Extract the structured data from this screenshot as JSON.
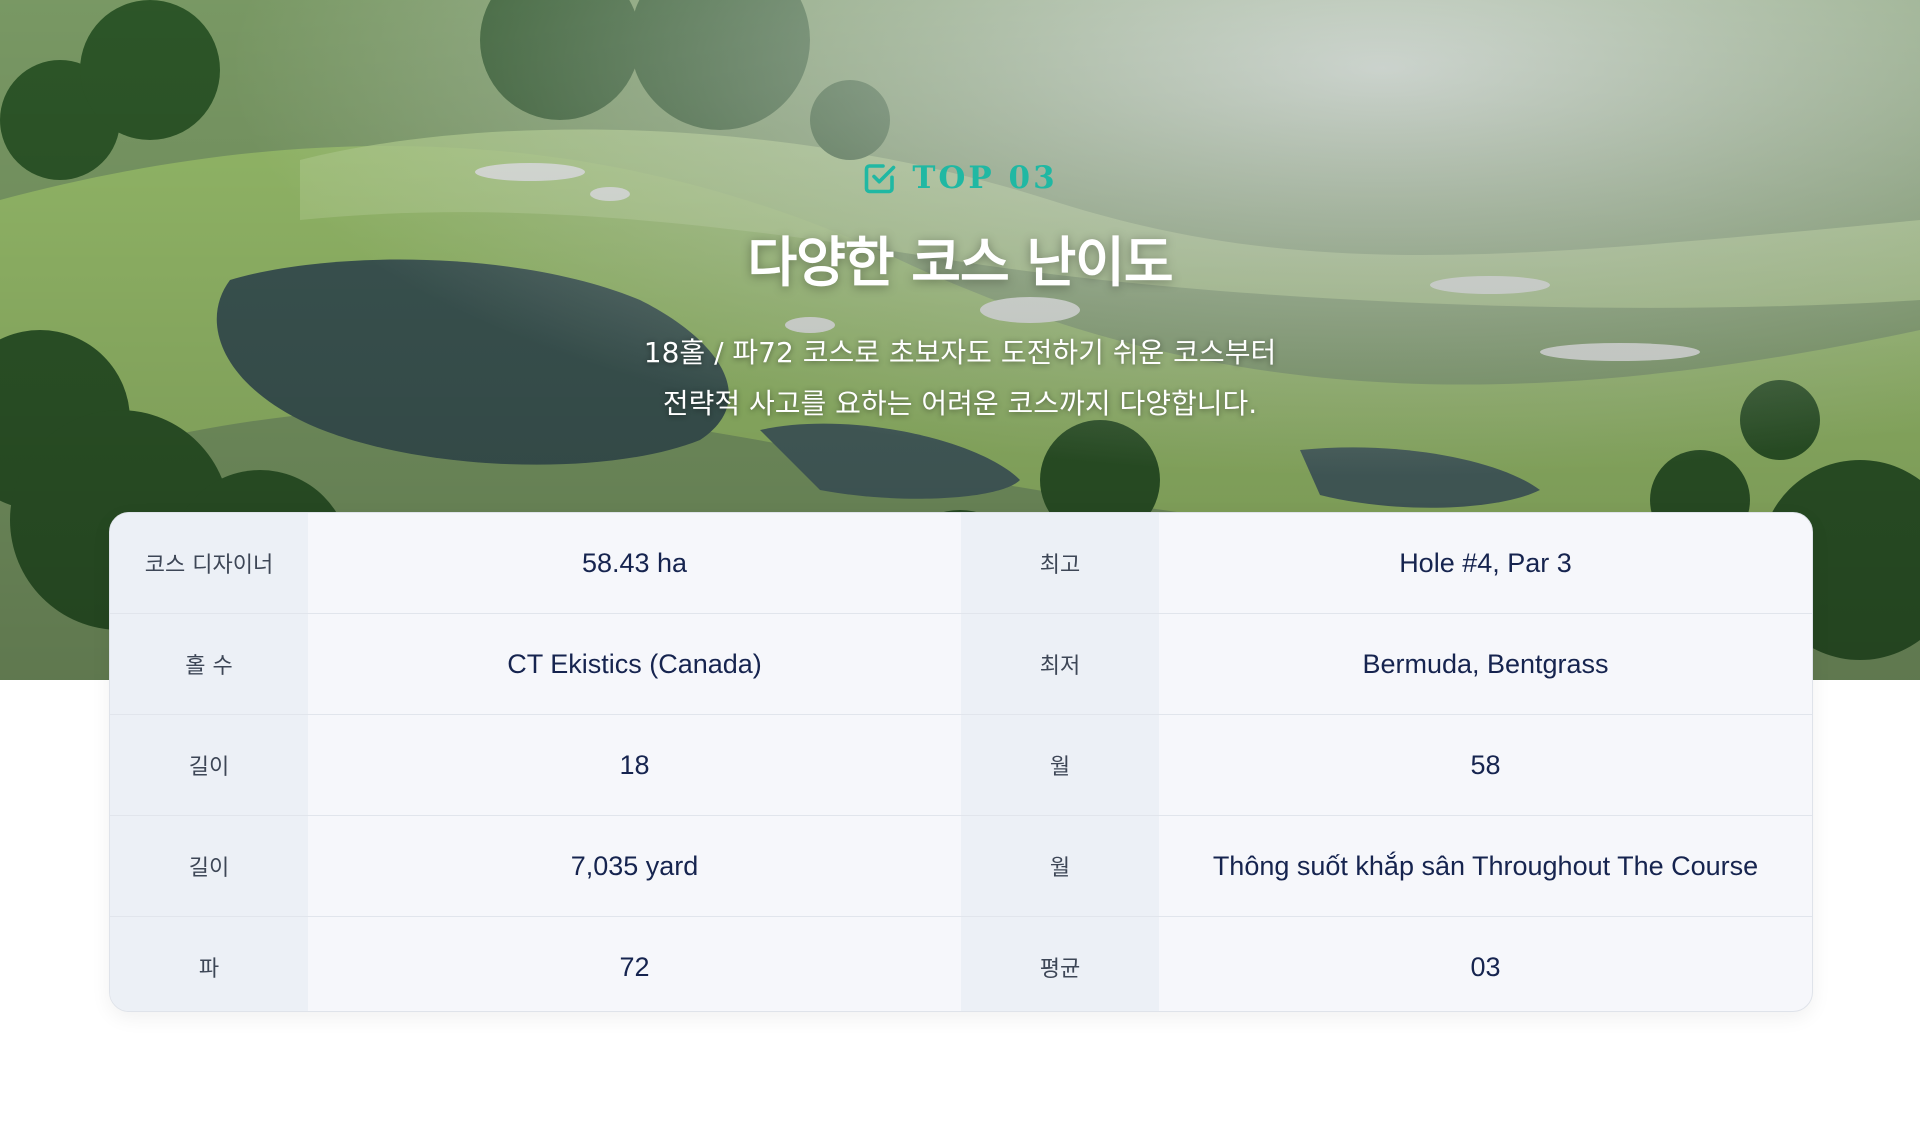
{
  "hero": {
    "badge_text": "TOP 03",
    "badge_icon": "check-square-icon",
    "title": "다양한 코스 난이도",
    "desc_line1": "18홀 / 파72 코스로 초보자도 도전하기 쉬운 코스부터",
    "desc_line2": "전략적 사고를 요하는 어려운 코스까지 다양합니다."
  },
  "colors": {
    "accent": "#20b8a3",
    "label_bg": "#ecf0f6",
    "value_text": "#16244f"
  },
  "table": {
    "rows": [
      {
        "label1": "코스 디자이너",
        "value1": "58.43 ha",
        "label2": "최고",
        "value2": "Hole #4, Par 3"
      },
      {
        "label1": "홀 수",
        "value1": "CT Ekistics (Canada)",
        "label2": "최저",
        "value2": "Bermuda, Bentgrass"
      },
      {
        "label1": "길이",
        "value1": "18",
        "label2": "월",
        "value2": "58"
      },
      {
        "label1": "길이",
        "value1": "7,035 yard",
        "label2": "월",
        "value2": "Thông suốt khắp sân Throughout The Course"
      },
      {
        "label1": "파",
        "value1": "72",
        "label2": "평균",
        "value2": "03"
      }
    ]
  }
}
